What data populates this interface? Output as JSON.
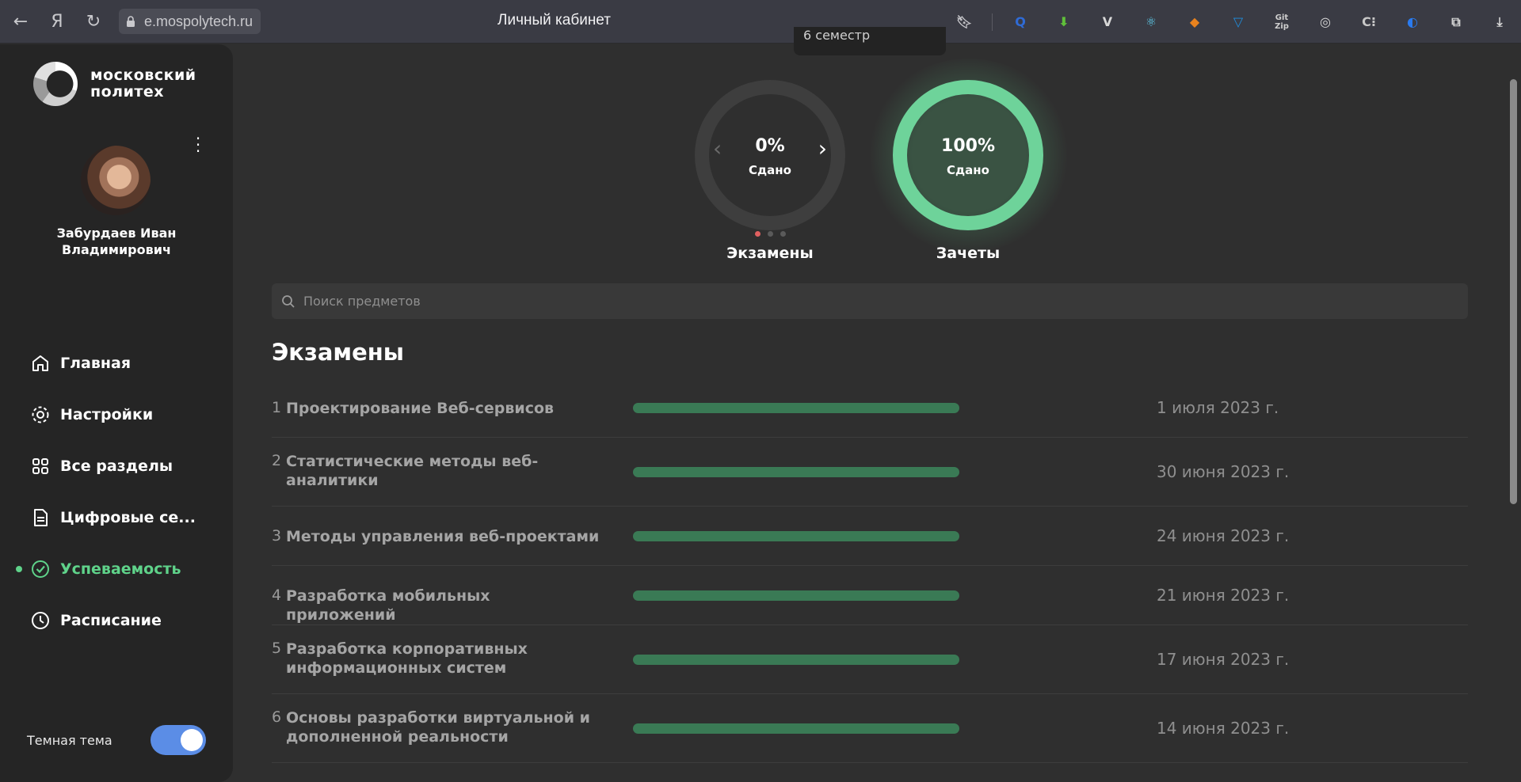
{
  "browser": {
    "url": "e.mospolytech.ru",
    "title": "Личный кабинет",
    "extensions": [
      {
        "icon": "search-ext-icon",
        "glyph": "Q",
        "color": "#2f6bd6"
      },
      {
        "icon": "download-arrow-ext-icon",
        "glyph": "⬇",
        "color": "#5fbf3a"
      },
      {
        "icon": "vue-devtools-ext-icon",
        "glyph": "V",
        "color": "#d8d8d8"
      },
      {
        "icon": "react-devtools-ext-icon",
        "glyph": "⚛",
        "color": "#5fd0f0"
      },
      {
        "icon": "metamask-ext-icon",
        "glyph": "◆",
        "color": "#e8821e"
      },
      {
        "icon": "tonkeeper-ext-icon",
        "glyph": "▽",
        "color": "#1f8fe0"
      },
      {
        "icon": "gitzip-ext-icon",
        "glyph": "Git\nZip",
        "color": "#cfcfcf"
      },
      {
        "icon": "target-ext-icon",
        "glyph": "◎",
        "color": "#d8d8d8"
      },
      {
        "icon": "code-ext-icon",
        "glyph": "C⁝",
        "color": "#c8c8c8"
      },
      {
        "icon": "blue-ext-icon",
        "glyph": "◐",
        "color": "#2a7bf0"
      },
      {
        "icon": "extensions-puzzle-icon",
        "glyph": "⧉",
        "color": "#d8d8d8"
      },
      {
        "icon": "downloads-icon",
        "glyph": "⤓",
        "color": "#d8d8d8"
      }
    ]
  },
  "sidebar": {
    "logo_line1": "московский",
    "logo_line2": "политех",
    "user_name": "Забурдаев Иван Владимирович",
    "nav": [
      {
        "label": "Главная",
        "icon": "home-icon",
        "active": false
      },
      {
        "label": "Настройки",
        "icon": "gear-icon",
        "active": false
      },
      {
        "label": "Все разделы",
        "icon": "grid-icon",
        "active": false
      },
      {
        "label": "Цифровые се...",
        "icon": "document-icon",
        "active": false
      },
      {
        "label": "Успеваемость",
        "icon": "check-circle-icon",
        "active": true
      },
      {
        "label": "Расписание",
        "icon": "clock-icon",
        "active": false
      }
    ],
    "theme_label": "Темная тема",
    "theme_on": true
  },
  "semester_tab": "6 семестр",
  "summary": {
    "exams": {
      "percent_text": "0%",
      "percent": 0,
      "sub": "Сдано",
      "label": "Экзамены"
    },
    "credits": {
      "percent_text": "100%",
      "percent": 100,
      "sub": "Сдано",
      "label": "Зачеты"
    }
  },
  "search_placeholder": "Поиск предметов",
  "section_title": "Экзамены",
  "exams": [
    {
      "num": "1",
      "name": "Проектирование Веб-сервисов",
      "date": "1 июля 2023 г.",
      "progress": 1
    },
    {
      "num": "2",
      "name": "Статистические методы веб-аналитики",
      "date": "30 июня 2023 г.",
      "progress": 1
    },
    {
      "num": "3",
      "name": "Методы управления веб-проектами",
      "date": "24 июня 2023 г.",
      "progress": 1
    },
    {
      "num": "4",
      "name": "Разработка мобильных приложений",
      "date": "21 июня 2023 г.",
      "progress": 1
    },
    {
      "num": "5",
      "name": "Разработка корпоративных информационных систем",
      "date": "17 июня 2023 г.",
      "progress": 1
    },
    {
      "num": "6",
      "name": "Основы разработки виртуальной и дополненной реальности",
      "date": "14 июня 2023 г.",
      "progress": 1
    }
  ],
  "colors": {
    "accent": "#5fd38a",
    "bar": "#3a7a55",
    "toggle": "#5b8de6",
    "active_dot": "#e06060"
  }
}
